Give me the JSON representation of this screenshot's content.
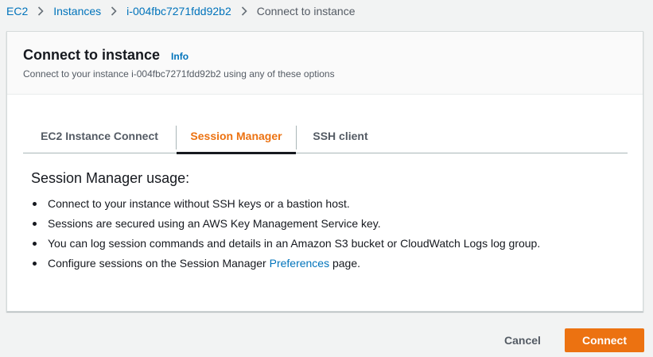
{
  "breadcrumb": {
    "items": [
      "EC2",
      "Instances",
      "i-004fbc7271fdd92b2"
    ],
    "current": "Connect to instance"
  },
  "panel": {
    "title": "Connect to instance",
    "info": "Info",
    "description": "Connect to your instance i-004fbc7271fdd92b2 using any of these options"
  },
  "tabs": [
    {
      "label": "EC2 Instance Connect"
    },
    {
      "label": "Session Manager"
    },
    {
      "label": "SSH client"
    }
  ],
  "usage": {
    "title": "Session Manager usage:",
    "items": [
      "Connect to your instance without SSH keys or a bastion host.",
      "Sessions are secured using an AWS Key Management Service key.",
      "You can log session commands and details in an Amazon S3 bucket or CloudWatch Logs log group."
    ],
    "pref_prefix": "Configure sessions on the Session Manager ",
    "pref_link": "Preferences",
    "pref_suffix": " page."
  },
  "footer": {
    "cancel": "Cancel",
    "connect": "Connect"
  },
  "colors": {
    "accent": "#ec7211",
    "link": "#0073bb"
  }
}
